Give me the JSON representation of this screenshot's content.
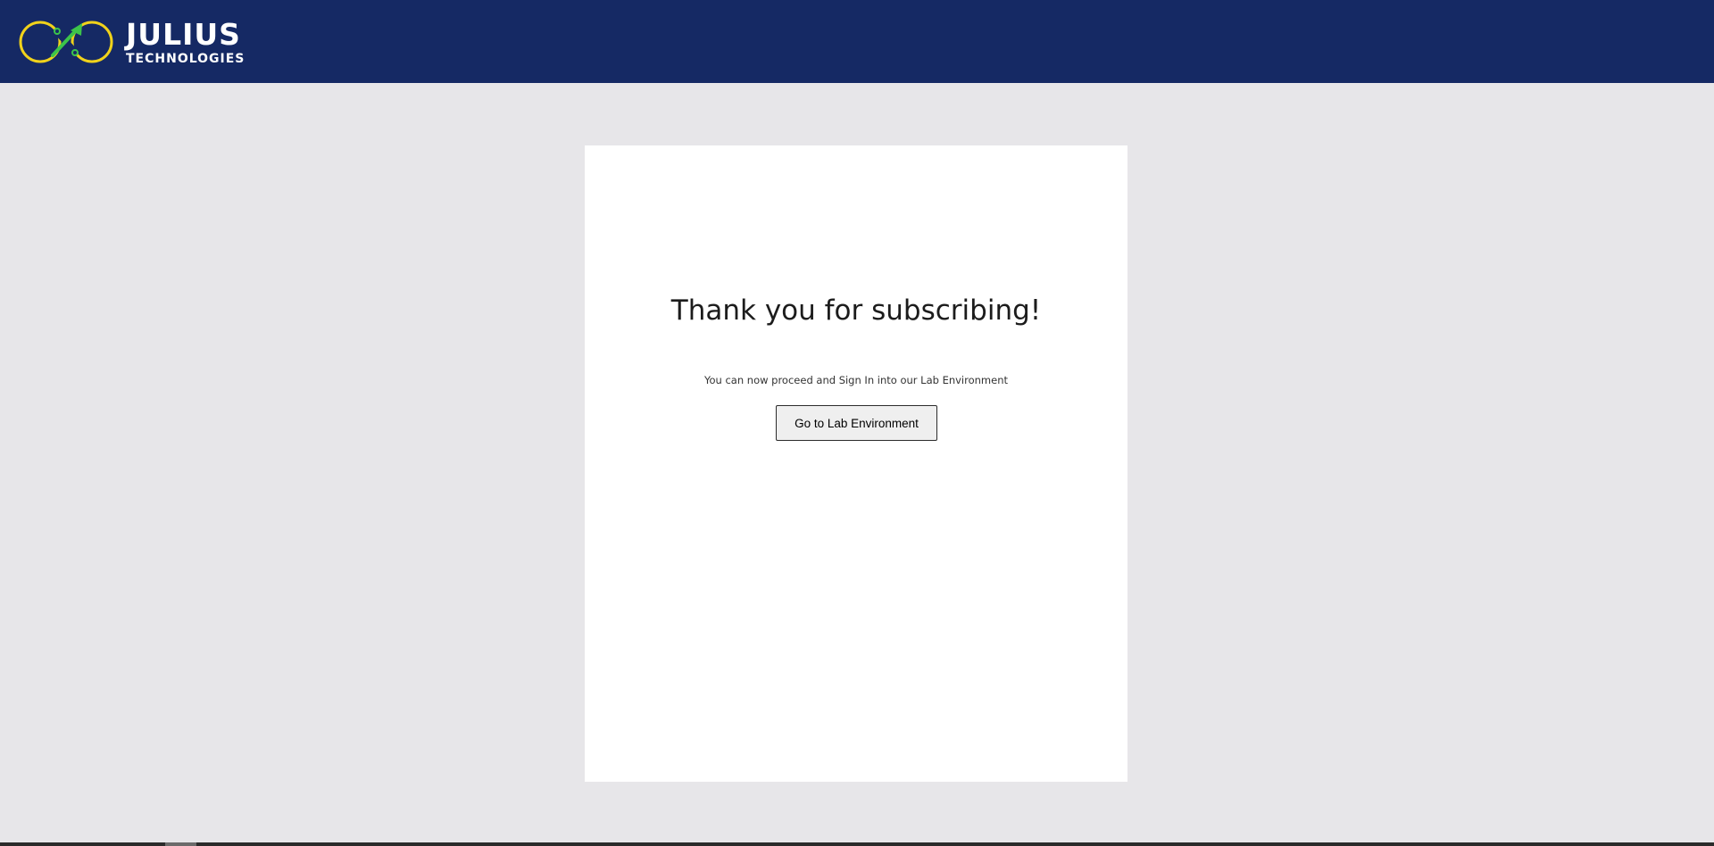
{
  "header": {
    "brand_name": "JULIUS",
    "brand_sub": "TECHNOLOGIES",
    "background_color": "#152964",
    "logo_icon": "infinity-growth-arrow-icon",
    "logo_colors": {
      "ring": "#f0d21b",
      "arrow": "#3cc44a"
    }
  },
  "main": {
    "title": "Thank you for subscribing!",
    "message": "You can now proceed and Sign In into our Lab Environment",
    "cta_label": "Go to Lab Environment"
  },
  "colors": {
    "page_background": "#e7e6e9",
    "card_background": "#ffffff"
  }
}
